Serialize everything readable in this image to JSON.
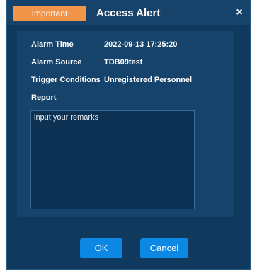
{
  "dialog": {
    "badge": "Important",
    "title": "Access Alert",
    "close_symbol": "×"
  },
  "details": {
    "alarm_time_label": "Alarm Time",
    "alarm_time_value": "2022-09-13 17:25:20",
    "alarm_source_label": "Alarm Source",
    "alarm_source_value": "TDB09test",
    "trigger_label": "Trigger Conditions",
    "trigger_value": "Unregistered Personnel",
    "report_label": "Report"
  },
  "remarks": {
    "placeholder": "input your remarks",
    "value": ""
  },
  "buttons": {
    "ok": "OK",
    "cancel": "Cancel"
  },
  "colors": {
    "dialog_background": "#0f3a5e",
    "panel_background": "#15436b",
    "badge_orange": "#f0954a",
    "button_blue": "#0c88e4"
  },
  "icons": {
    "close": "close-icon"
  }
}
